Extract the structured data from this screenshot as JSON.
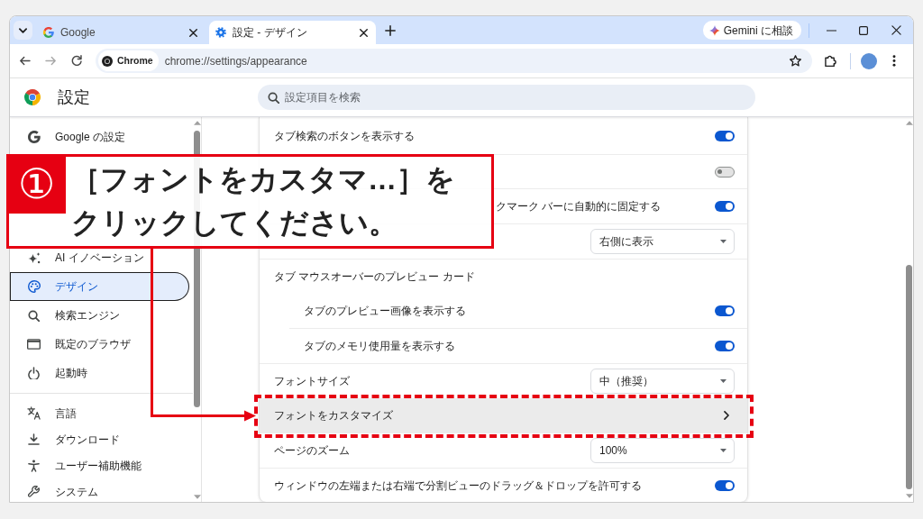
{
  "window": {
    "tabs": [
      {
        "title": "Google",
        "selected": false
      },
      {
        "title": "設定 - デザイン",
        "selected": true
      }
    ],
    "gemini_button": "Gemini に相談"
  },
  "toolbar": {
    "site_chip": "Chrome",
    "url": "chrome://settings/appearance"
  },
  "header": {
    "title": "設定",
    "search": {
      "placeholder": "設定項目を検索"
    }
  },
  "sidebar": {
    "groups": [
      [
        {
          "label": "Google の設定",
          "selected": false
        },
        {
          "label": "AI イノベーション",
          "selected": false
        },
        {
          "label": "デザイン",
          "selected": true
        },
        {
          "label": "検索エンジン",
          "selected": false
        },
        {
          "label": "既定のブラウザ",
          "selected": false
        },
        {
          "label": "起動時",
          "selected": false
        }
      ],
      [
        {
          "label": "言語",
          "selected": false
        },
        {
          "label": "ダウンロード",
          "selected": false
        },
        {
          "label": "ユーザー補助機能",
          "selected": false
        },
        {
          "label": "システム",
          "selected": false
        }
      ]
    ]
  },
  "settings": {
    "rows": [
      {
        "kind": "toggle",
        "label": "タブ検索のボタンを表示する",
        "on": true
      },
      {
        "kind": "toggle",
        "on": false
      },
      {
        "kind": "toggle",
        "label": "クマーク バーに自動的に固定する",
        "on": true
      },
      {
        "kind": "dropdown",
        "value": "右側に表示"
      },
      {
        "kind": "section",
        "label": "タブ マウスオーバーのプレビュー カード",
        "children": [
          {
            "kind": "toggle",
            "label": "タブのプレビュー画像を表示する",
            "on": true
          },
          {
            "kind": "toggle",
            "label": "タブのメモリ使用量を表示する",
            "on": true
          }
        ]
      },
      {
        "kind": "dropdown",
        "label": "フォントサイズ",
        "value": "中（推奨）"
      },
      {
        "kind": "link",
        "label": "フォントをカスタマイズ",
        "hovered": true
      },
      {
        "kind": "dropdown",
        "label": "ページのズーム",
        "value": "100%"
      },
      {
        "kind": "toggle",
        "label": "ウィンドウの左端または右端で分割ビューのドラッグ＆ドロップを許可する",
        "on": true
      }
    ]
  },
  "callout": {
    "number": "①",
    "text": "［フォントをカスタマ…］をクリックしてください。"
  }
}
